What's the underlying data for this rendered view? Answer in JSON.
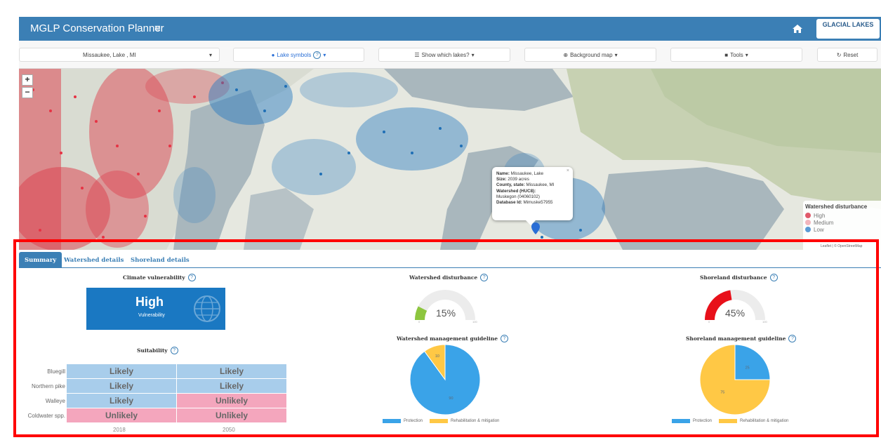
{
  "header": {
    "title": "MGLP Conservation Planner",
    "menu_icon": "hamburger-icon",
    "home_icon": "home-icon",
    "logo_text": "GLACIAL LAKES"
  },
  "toolbar": {
    "lake_select": "Missaukee, Lake , MI",
    "lake_symbols": "Lake symbols",
    "show_lakes": "Show which lakes?",
    "background_map": "Background map",
    "tools": "Tools",
    "reset": "Reset"
  },
  "map": {
    "zoom_in": "+",
    "zoom_out": "−",
    "popup": {
      "name_label": "Name:",
      "name": "Missaukee, Lake",
      "size_label": "Size:",
      "size": "2039 acres",
      "county_label": "County, state:",
      "county": "Missaukee, MI",
      "watershed_label": "Watershed (HUC8):",
      "watershed": "Muskegon (04060102)",
      "dbid_label": "Database Id:",
      "dbid": "Mimuske57955"
    },
    "legend": {
      "title": "Watershed disturbance",
      "items": [
        {
          "label": "High",
          "color": "#e05a6a"
        },
        {
          "label": "Medium",
          "color": "#f2b6bd"
        },
        {
          "label": "Low",
          "color": "#5b9bd5"
        }
      ]
    },
    "attribution": "Leaflet | © OpenStreetMap"
  },
  "tabs": [
    "Summary",
    "Watershed details",
    "Shoreland details"
  ],
  "climate": {
    "title": "Climate vulnerability",
    "level": "High",
    "sub": "Vulnerability"
  },
  "suitability": {
    "title": "Suitability",
    "years": [
      "2018",
      "2050"
    ],
    "rows": [
      {
        "species": "Bluegill",
        "values": [
          "Likely",
          "Likely"
        ]
      },
      {
        "species": "Northern pike",
        "values": [
          "Likely",
          "Likely"
        ]
      },
      {
        "species": "Walleye",
        "values": [
          "Likely",
          "Unlikely"
        ]
      },
      {
        "species": "Coldwater spp.",
        "values": [
          "Unlikely",
          "Unlikely"
        ]
      }
    ],
    "colors": {
      "Likely": "#a8cdeb",
      "Unlikely": "#f4a6bd"
    }
  },
  "watershed_disturbance": {
    "title": "Watershed disturbance",
    "value": 15,
    "label": "15%",
    "min": "0",
    "max": "100",
    "color": "#8dc63f"
  },
  "shoreland_disturbance": {
    "title": "Shoreland disturbance",
    "value": 45,
    "label": "45%",
    "min": "0",
    "max": "100",
    "color": "#e8101a"
  },
  "watershed_guideline": {
    "title": "Watershed management guideline",
    "legend": [
      "Protection",
      "Rehabilitation & mitigation"
    ]
  },
  "shoreland_guideline": {
    "title": "Shoreland management guideline",
    "legend": [
      "Protection",
      "Rehabilitation & mitigation"
    ]
  },
  "chart_data": [
    {
      "type": "pie",
      "title": "Watershed management guideline",
      "categories": [
        "Protection",
        "Rehabilitation & mitigation"
      ],
      "values": [
        90,
        10
      ],
      "data_labels": [
        "90",
        "10"
      ],
      "colors": [
        "#3aa3e8",
        "#ffc845"
      ]
    },
    {
      "type": "pie",
      "title": "Shoreland management guideline",
      "categories": [
        "Protection",
        "Rehabilitation & mitigation"
      ],
      "values": [
        25,
        75
      ],
      "data_labels": [
        "25",
        "75"
      ],
      "colors": [
        "#3aa3e8",
        "#ffc845"
      ]
    }
  ]
}
